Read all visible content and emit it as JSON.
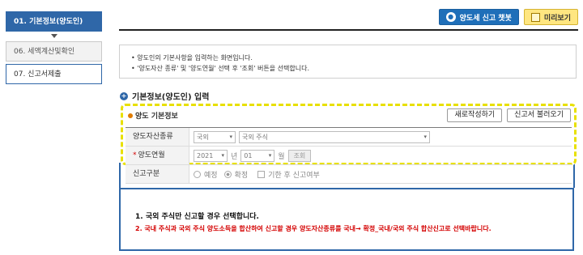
{
  "steps": [
    {
      "label": "01. 기본정보(양도인)"
    },
    {
      "label": "06. 세액계산및확인"
    },
    {
      "label": "07. 신고서제출"
    }
  ],
  "toolbar": {
    "chatbot_label": "양도세 신고 챗봇",
    "preview_label": "미리보기"
  },
  "notice": {
    "line1": "• 양도인의 기본사항을 입력하는 화면입니다.",
    "line2": "• '양도자산 종류' 및 '양도연월' 선택 후 '조회' 버튼을 선택합니다."
  },
  "section": {
    "title": "기본정보(양도인) 입력"
  },
  "panel": {
    "title": "양도 기본정보",
    "new_button": "새로작성하기",
    "load_button": "신고서 불러오기"
  },
  "form": {
    "asset_type_label": "양도자산종류",
    "asset_type_select1": "국외",
    "asset_type_select2": "국외 주식",
    "date_label": "양도연월",
    "year_value": "2021",
    "year_unit": "년",
    "month_value": "01",
    "month_unit": "월",
    "lookup_button": "조회",
    "report_type_label": "신고구분",
    "option_scheduled": "예정",
    "option_final": "확정",
    "option_late": "기한 후 신고여부"
  },
  "guide": {
    "line1": "1. 국외 주식만 신고할 경우 선택합니다.",
    "line2": "2. 국내 주식과 국외 주식 양도소득을 합산하여 신고할 경우 양도자산종류를 국내→ 확정_국내/국외 주식 합산신고로 선택바랍니다."
  },
  "colors": {
    "accent": "#2f67a8",
    "highlight": "#e8e000",
    "warning_text": "#d40000"
  }
}
